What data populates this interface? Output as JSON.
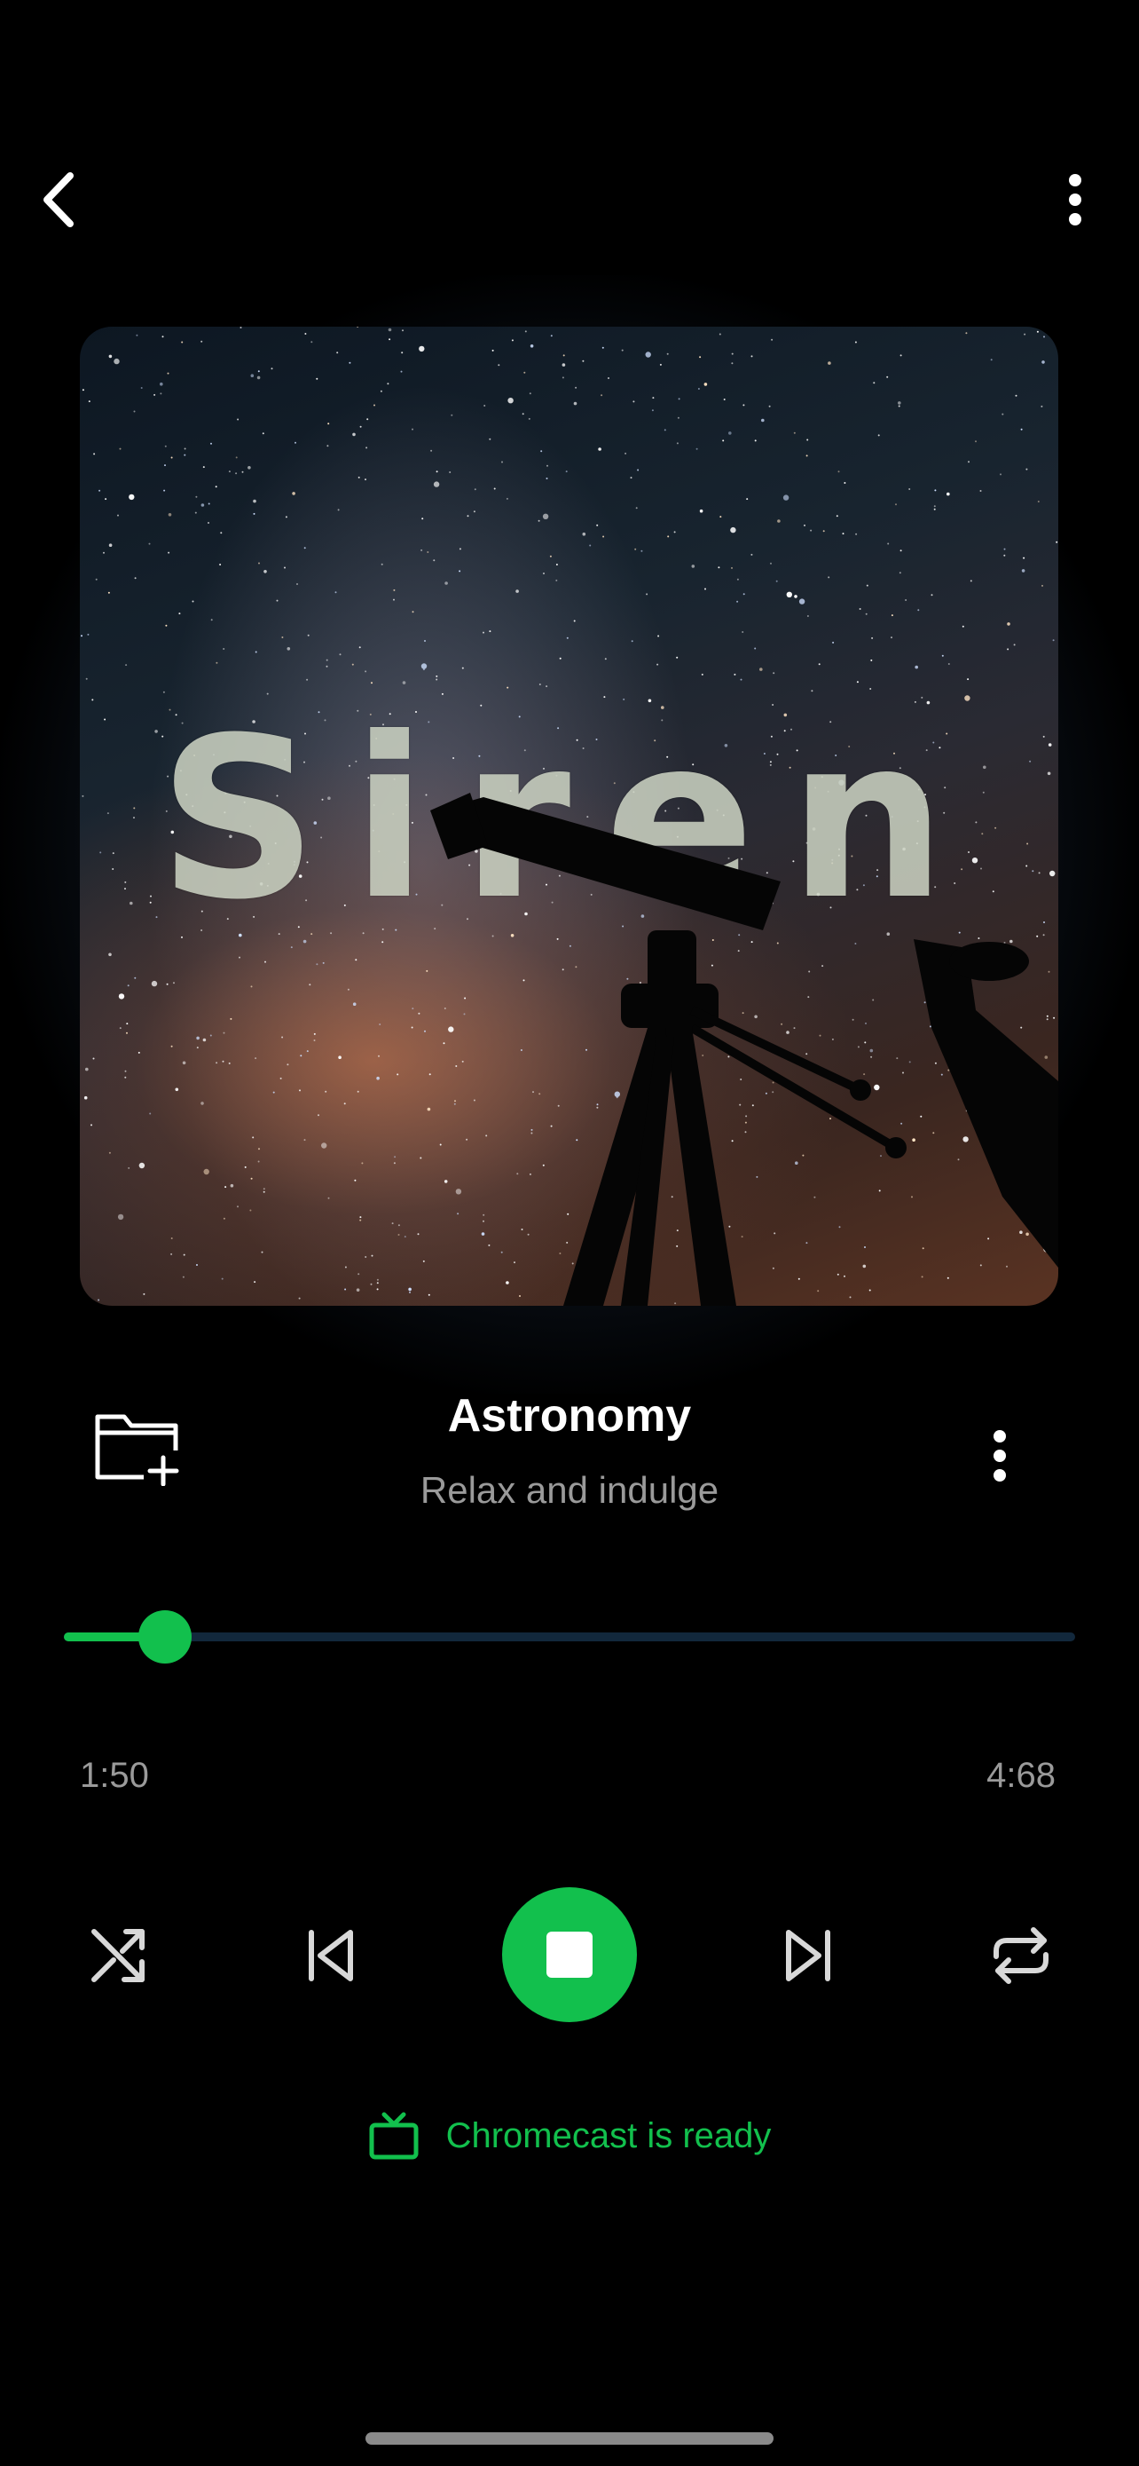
{
  "album_art": {
    "overlay_text": "Siren"
  },
  "track": {
    "title": "Astronomy",
    "subtitle": "Relax and indulge"
  },
  "progress": {
    "elapsed": "1:50",
    "total": "4:68",
    "fraction": 0.1
  },
  "cast": {
    "label": "Chromecast is ready"
  },
  "icons": {
    "back": "chevron-left-icon",
    "more": "more-vertical-icon",
    "add_to_folder": "folder-plus-icon",
    "shuffle": "shuffle-icon",
    "previous": "skip-previous-icon",
    "stop": "stop-icon",
    "next": "skip-next-icon",
    "repeat": "repeat-icon",
    "cast": "tv-icon"
  },
  "colors": {
    "accent": "#12c04d",
    "background": "#000000",
    "secondary_text": "#9a9a9a",
    "track_bg": "#12283c"
  }
}
